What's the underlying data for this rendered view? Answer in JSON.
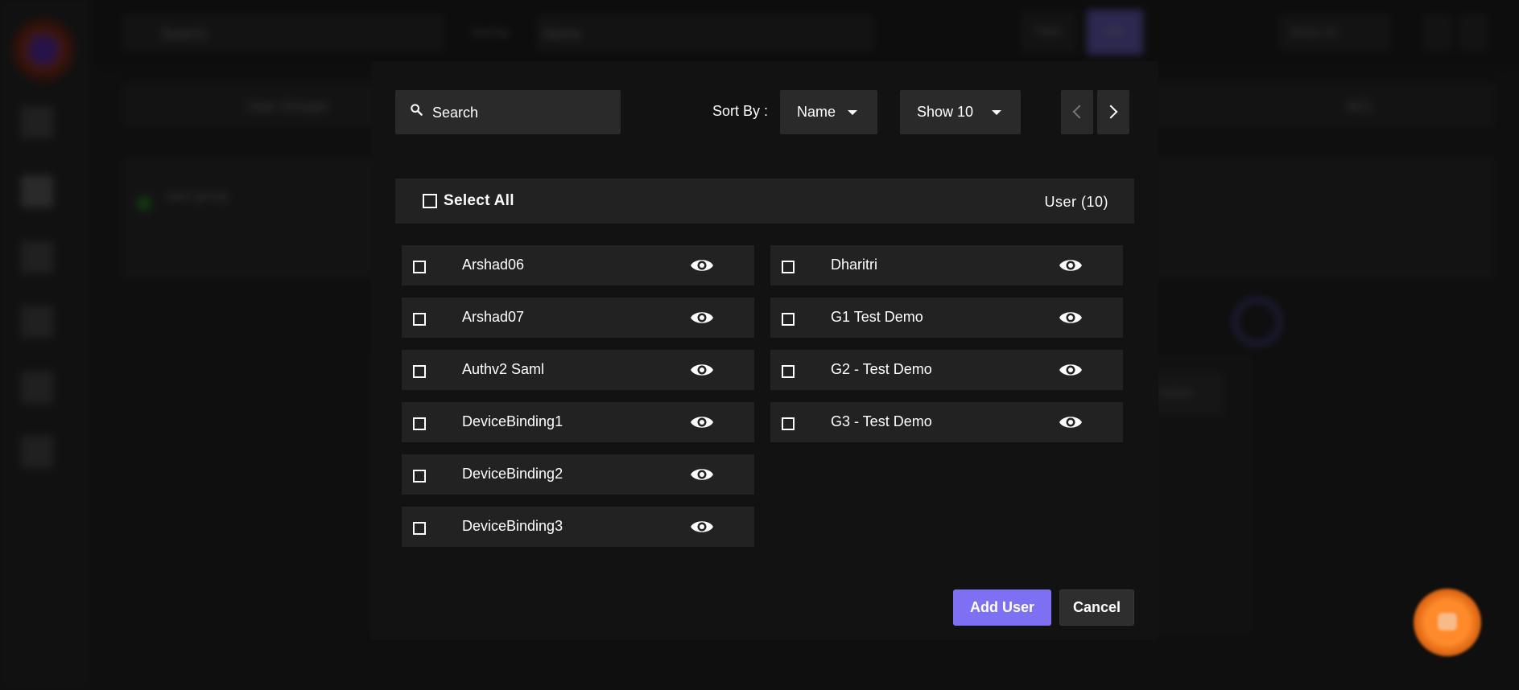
{
  "background": {
    "search_placeholder": "Search",
    "sort_by_label": "Sort by",
    "sort_value": "Name",
    "view_button": "View",
    "list_button": "List",
    "show_label": "Show 10",
    "header_col1": "User Groups",
    "header_col2": "ACL",
    "group_name": "user-group",
    "bg_button": "Action"
  },
  "modal": {
    "search": {
      "placeholder": "Search"
    },
    "sort": {
      "label": "Sort By :",
      "value": "Name"
    },
    "show": {
      "value": "Show 10"
    },
    "select_all_label": "Select All",
    "count_label": "User (10)",
    "users_left": [
      {
        "name": "Arshad06"
      },
      {
        "name": "Arshad07"
      },
      {
        "name": "Authv2 Saml"
      },
      {
        "name": "DeviceBinding1"
      },
      {
        "name": "DeviceBinding2"
      },
      {
        "name": "DeviceBinding3"
      }
    ],
    "users_right": [
      {
        "name": "Dharitri"
      },
      {
        "name": "G1 Test Demo"
      },
      {
        "name": "G2 - Test Demo"
      },
      {
        "name": "G3 - Test Demo"
      }
    ],
    "add_button": "Add User",
    "cancel_button": "Cancel"
  },
  "icons": {
    "search": "search-icon",
    "dropdown": "caret-down-icon",
    "prev": "chevron-left-icon",
    "next": "chevron-right-icon",
    "eye": "eye-icon"
  },
  "colors": {
    "accent": "#7b71f2",
    "modal_bg": "#121212",
    "row_bg": "#222222"
  }
}
